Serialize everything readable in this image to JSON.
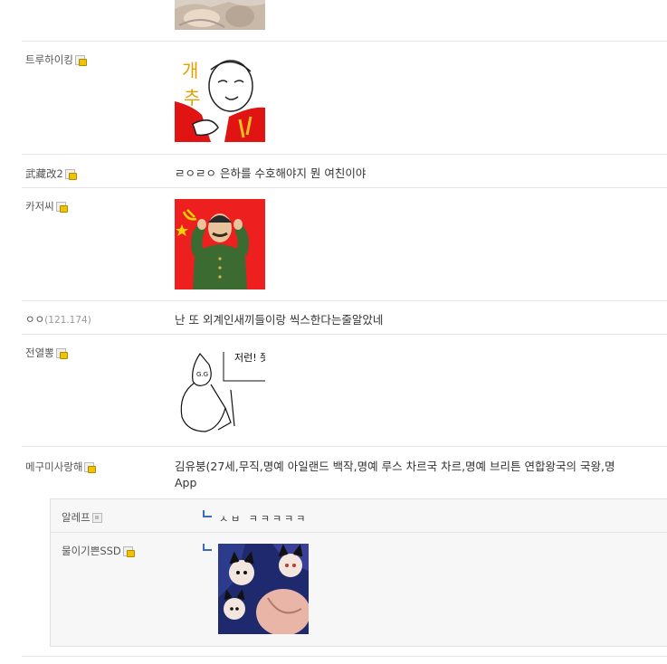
{
  "comments": [
    {
      "nick": "트루하이킹",
      "icon": "fixed"
    },
    {
      "nick": "武藏改2",
      "icon": "fixed",
      "text": "ㄹㅇㄹㅇ 은하를 수호해야지 뭔 여친이야"
    },
    {
      "nick": "카저씨",
      "icon": "fixed"
    },
    {
      "nick": "ㅇㅇ",
      "ip": "(121.174)",
      "text": "난 또 외계인새끼들이랑 씩스한다는줄알았네"
    },
    {
      "nick": "전열뽕",
      "icon": "fixed",
      "image_text": "저런! 쯧쯧"
    },
    {
      "nick": "메구미사랑해",
      "icon": "fixed",
      "text_line1": "김유붕(27세,무직,명예 아일랜드 백작,명예 루스 차르국 차르,명예 브리튼 연합왕국의 국왕,명",
      "text_line2": "App"
    }
  ],
  "replies": [
    {
      "nick": "알레프",
      "icon": "half",
      "text": "ㅅㅂ ㅋㅋㅋㅋㅋ"
    },
    {
      "nick": "물이기쁜SSD",
      "icon": "fixed"
    }
  ],
  "colors": {
    "soviet_red": "#ee1f1f",
    "reply_arrow": "#3a6cc2",
    "row_border": "#e5e5e5"
  }
}
